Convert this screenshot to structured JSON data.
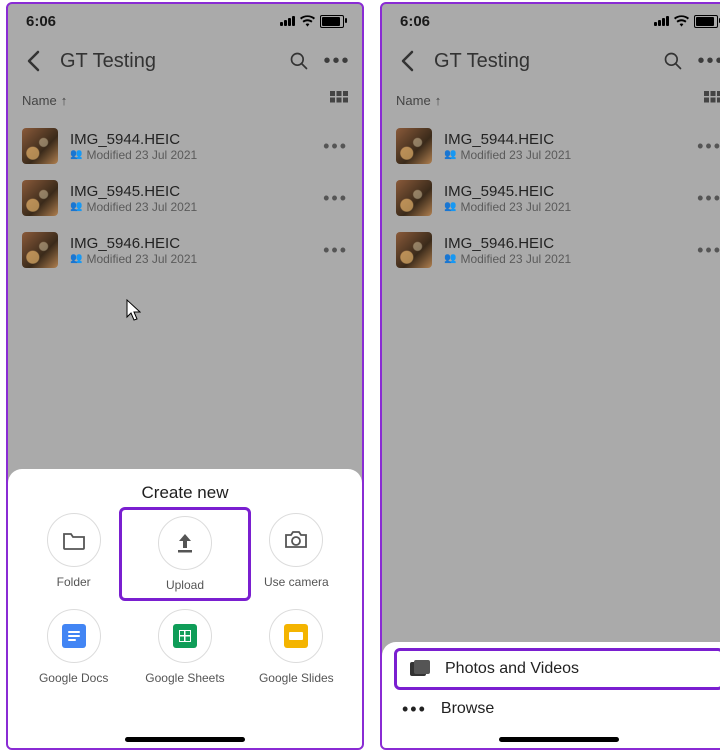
{
  "status": {
    "time": "6:06"
  },
  "appbar": {
    "title": "GT Testing"
  },
  "sort": {
    "label": "Name",
    "direction_glyph": "↑"
  },
  "files": [
    {
      "name": "IMG_5944.HEIC",
      "subtitle": "Modified 23 Jul 2021"
    },
    {
      "name": "IMG_5945.HEIC",
      "subtitle": "Modified 23 Jul 2021"
    },
    {
      "name": "IMG_5946.HEIC",
      "subtitle": "Modified 23 Jul 2021"
    }
  ],
  "create_sheet": {
    "title": "Create new",
    "items": [
      {
        "key": "folder",
        "label": "Folder"
      },
      {
        "key": "upload",
        "label": "Upload"
      },
      {
        "key": "camera",
        "label": "Use camera"
      },
      {
        "key": "docs",
        "label": "Google Docs"
      },
      {
        "key": "sheets",
        "label": "Google Sheets"
      },
      {
        "key": "slides",
        "label": "Google Slides"
      }
    ],
    "highlighted": "upload"
  },
  "picker_sheet": {
    "items": [
      {
        "key": "photos",
        "label": "Photos and Videos",
        "highlighted": true
      },
      {
        "key": "browse",
        "label": "Browse",
        "highlighted": false
      }
    ]
  },
  "colors": {
    "accent": "#7a1fd0"
  }
}
